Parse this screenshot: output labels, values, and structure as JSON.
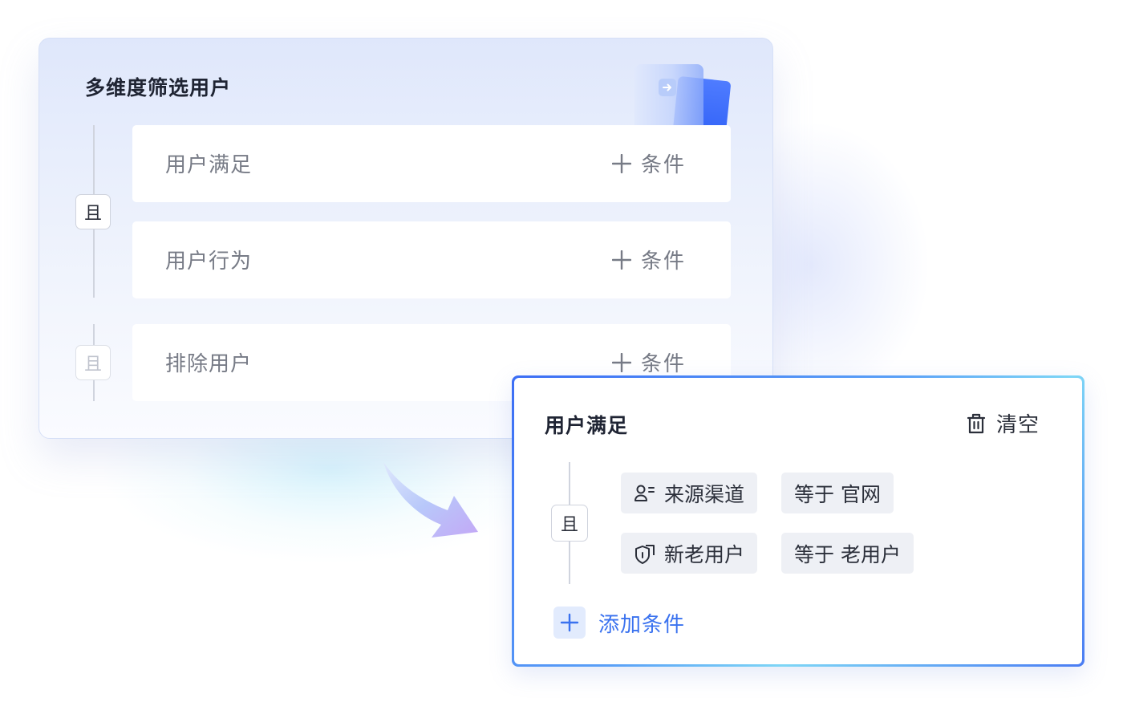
{
  "back_panel": {
    "title": "多维度筛选用户",
    "connector_1": "且",
    "connector_2": "且",
    "rows": [
      {
        "label": "用户满足",
        "action": "条件"
      },
      {
        "label": "用户行为",
        "action": "条件"
      },
      {
        "label": "排除用户",
        "action": "条件"
      }
    ]
  },
  "front_panel": {
    "title": "用户满足",
    "clear_label": "清空",
    "connector": "且",
    "conditions": [
      {
        "field": "来源渠道",
        "field_icon": "user-list-icon",
        "value": "等于 官网"
      },
      {
        "field": "新老用户",
        "field_icon": "tag-shield-icon",
        "value": "等于 老用户"
      }
    ],
    "add_label": "添加条件"
  },
  "colors": {
    "accent": "#3a72ef",
    "chip_bg": "#eef0f5",
    "border_gradient_start": "#3c6ef5",
    "border_gradient_mid": "#7ed6f6"
  }
}
